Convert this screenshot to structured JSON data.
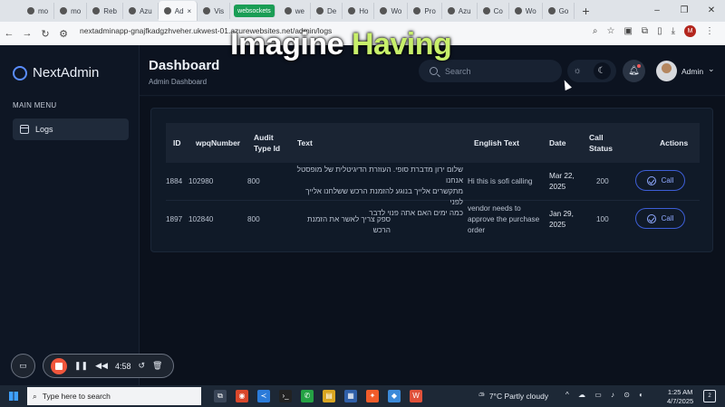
{
  "browser": {
    "tabs": [
      {
        "label": "mo"
      },
      {
        "label": "mo"
      },
      {
        "label": "Reb"
      },
      {
        "label": "Azu"
      },
      {
        "label": "Ad"
      },
      {
        "label": "Vis"
      },
      {
        "label": "websockets",
        "pill": true
      },
      {
        "label": "we"
      },
      {
        "label": "De"
      },
      {
        "label": "Ho"
      },
      {
        "label": "Wo"
      },
      {
        "label": "Pro"
      },
      {
        "label": "Azu"
      },
      {
        "label": "Co"
      },
      {
        "label": "Wo"
      },
      {
        "label": "Go"
      }
    ],
    "url": "nextadminapp-gnajfkadgzhveher.ukwest-01.azurewebsites.net/admin/logs",
    "profile_initial": "M"
  },
  "caption": {
    "white": "Imagine",
    "highlight": "Having"
  },
  "sidebar": {
    "app_name": "NextAdmin",
    "menu_heading": "MAIN MENU",
    "items": [
      {
        "label": "Logs",
        "icon": "calendar-icon"
      }
    ]
  },
  "header": {
    "title": "Dashboard",
    "subtitle": "Admin Dashboard",
    "search_placeholder": "Search",
    "user_name": "Admin"
  },
  "table": {
    "columns": {
      "id": "ID",
      "wpq": "wpqNumber",
      "audit_1": "Audit",
      "audit_2": "Type Id",
      "text": "Text",
      "english": "English Text",
      "date": "Date",
      "status_1": "Call",
      "status_2": "Status",
      "actions": "Actions"
    },
    "rows": [
      {
        "id": "1884",
        "wpq": "102980",
        "audit": "800",
        "text_1": "שלום ירון מדברת סופי. העוזרת הדיגיטלית של מופסטל אנחנו",
        "text_2": "מתקשרים אלייך בנוגע להזמנת הרכש ששלחנו אלייך לפני",
        "text_3": "כמה ימים האם אתה פנוי לדבר",
        "english_1": "Hi this is sofi calling",
        "english_2": "",
        "english_3": "",
        "date_1": "Mar 22,",
        "date_2": "2025",
        "status": "200",
        "action": "Call"
      },
      {
        "id": "1897",
        "wpq": "102840",
        "audit": "800",
        "text_1": "ספק צריך לאשר את הזמנת הרכש",
        "text_2": "",
        "text_3": "",
        "english_1": "vendor needs to",
        "english_2": "approve the purchase",
        "english_3": "order",
        "date_1": "Jan 29,",
        "date_2": "2025",
        "status": "100",
        "action": "Call"
      }
    ]
  },
  "recorder": {
    "time": "4:58"
  },
  "taskbar": {
    "search_placeholder": "Type here to search",
    "weather": "7°C  Partly cloudy",
    "time": "1:25 AM",
    "date": "4/7/2025",
    "notifications": "2"
  },
  "colors": {
    "accent": "#5a8dff",
    "background": "#0c1320",
    "caption_highlight": "#c8f06a"
  }
}
